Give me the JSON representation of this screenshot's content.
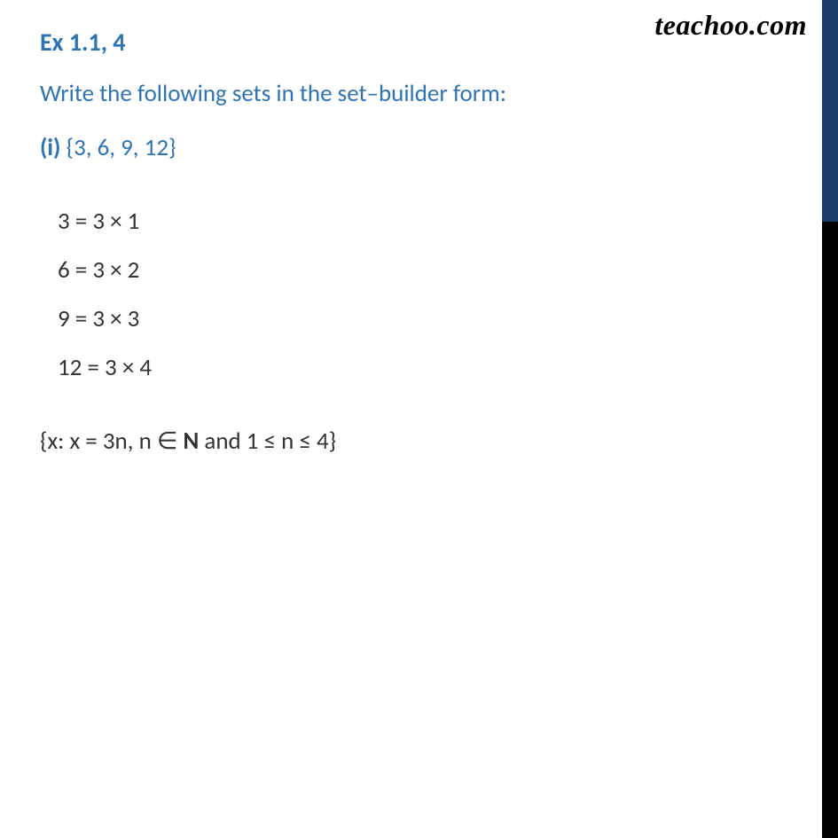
{
  "watermark": "teachoo.com",
  "heading": "Ex 1.1, 4",
  "question": "Write the following sets in the set–builder form:",
  "subPart": {
    "label": "(i)",
    "content": "{3, 6, 9, 12}"
  },
  "working": [
    "3 = 3 × 1",
    "6 = 3 × 2",
    "9 = 3 × 3",
    "12 = 3 × 4"
  ],
  "answer": {
    "prefix": "{x: x = 3n, n ∈ ",
    "bold": "N",
    "suffix": " and 1 ≤ n ≤ 4}"
  }
}
